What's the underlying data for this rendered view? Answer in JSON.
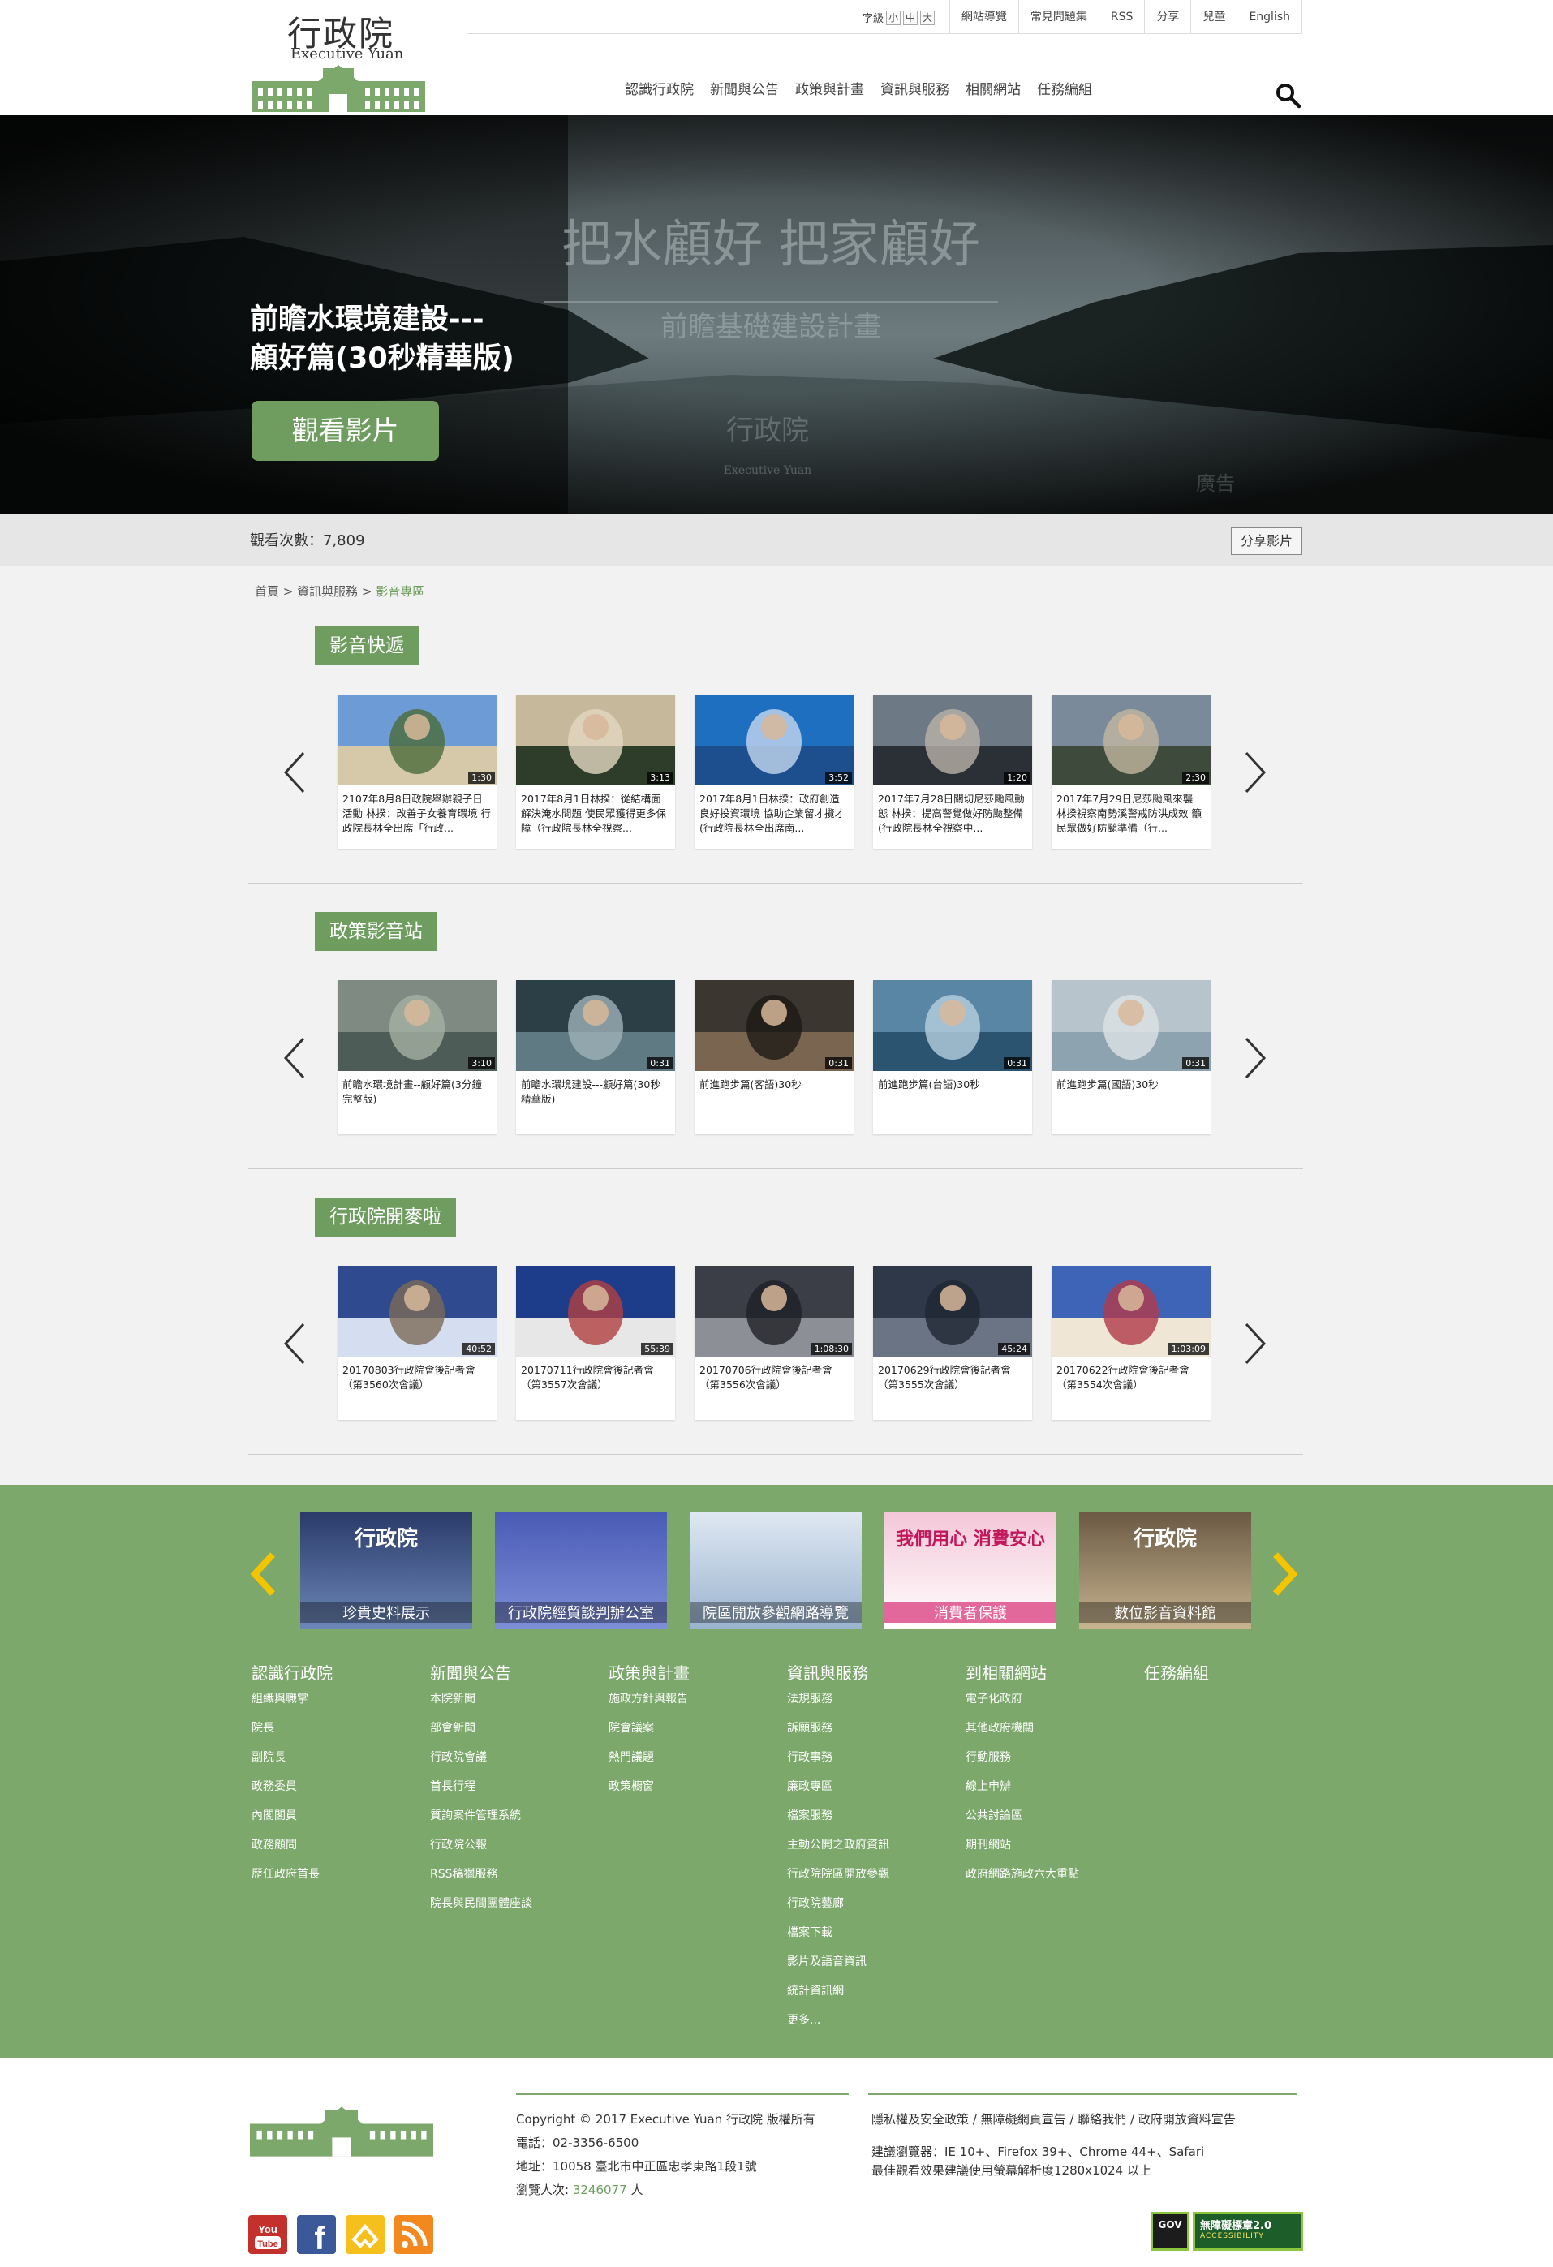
{
  "header": {
    "logo_title": "行政院",
    "logo_sub": "Executive Yuan",
    "font_size_label": "字級",
    "font_sizes": [
      "小",
      "中",
      "大"
    ],
    "top_links": [
      "網站導覽",
      "常見問題集",
      "RSS",
      "分享",
      "兒童",
      "English"
    ],
    "nav": [
      "認識行政院",
      "新聞與公告",
      "政策與計畫",
      "資訊與服務",
      "相關網站",
      "任務編組"
    ]
  },
  "hero": {
    "image_text": "把水顧好 把家顧好",
    "image_subtext": "前瞻基礎建設計畫",
    "watermark_title": "行政院",
    "watermark_sub": "Executive Yuan",
    "corner_text": "廣告",
    "title_line1": "前瞻水環境建設---",
    "title_line2": "顧好篇(30秒精華版)",
    "button": "觀看影片"
  },
  "viewbar": {
    "count_text": "觀看次數：7,809",
    "share": "分享影片"
  },
  "breadcrumb": {
    "home": "首頁",
    "sep": " > ",
    "parent": "資訊與服務",
    "current": "影音專區"
  },
  "sections": [
    {
      "title": "影音快遞",
      "cards": [
        {
          "duration": "1:30",
          "caption": "2107年8月8日政院舉辦親子日活動 林揆：改善子女養育環境 行政院長林全出席「行政..."
        },
        {
          "duration": "3:13",
          "caption": "2017年8月1日林揆：從結構面解決淹水問題 使民眾獲得更多保障（行政院長林全視察..."
        },
        {
          "duration": "3:52",
          "caption": "2017年8月1日林揆：政府創造良好投資環境 協助企業留才攬才(行政院長林全出席南..."
        },
        {
          "duration": "1:20",
          "caption": "2017年7月28日關切尼莎颱風動態 林揆：提高警覺做好防颱整備(行政院長林全視察中..."
        },
        {
          "duration": "2:30",
          "caption": "2017年7月29日尼莎颱風來襲 林揆視察南勢溪警戒防洪成效 籲民眾做好防颱準備（行..."
        }
      ]
    },
    {
      "title": "政策影音站",
      "cards": [
        {
          "duration": "3:10",
          "caption": "前瞻水環境計畫--顧好篇(3分鐘完整版)"
        },
        {
          "duration": "0:31",
          "caption": "前瞻水環境建設---顧好篇(30秒精華版)"
        },
        {
          "duration": "0:31",
          "caption": "前進跑步篇(客語)30秒"
        },
        {
          "duration": "0:31",
          "caption": "前進跑步篇(台語)30秒"
        },
        {
          "duration": "0:31",
          "caption": "前進跑步篇(國語)30秒"
        }
      ]
    },
    {
      "title": "行政院開麥啦",
      "cards": [
        {
          "duration": "40:52",
          "caption": "20170803行政院會後記者會（第3560次會議）"
        },
        {
          "duration": "55:39",
          "caption": "20170711行政院會後記者會（第3557次會議）"
        },
        {
          "duration": "1:08:30",
          "caption": "20170706行政院會後記者會（第3556次會議）"
        },
        {
          "duration": "45:24",
          "caption": "20170629行政院會後記者會（第3555次會議）"
        },
        {
          "duration": "1:03:09",
          "caption": "20170622行政院會後記者會（第3554次會議）"
        }
      ]
    }
  ],
  "banners": [
    {
      "label": "珍貴史料展示",
      "top": "行政院"
    },
    {
      "label": "行政院經貿談判辦公室",
      "top": ""
    },
    {
      "label": "院區開放參觀網路導覽",
      "top": ""
    },
    {
      "label": "消費者保護",
      "top": "我們用心 消費安心"
    },
    {
      "label": "數位影音資料館",
      "top": "行政院"
    }
  ],
  "footer_columns": [
    {
      "heading": "認識行政院",
      "items": [
        "組織與職掌",
        "院長",
        "副院長",
        "政務委員",
        "內閣閣員",
        "政務顧問",
        "歷任政府首長"
      ]
    },
    {
      "heading": "新聞與公告",
      "items": [
        "本院新聞",
        "部會新聞",
        "行政院會議",
        "首長行程",
        "質詢案件管理系統",
        "行政院公報",
        "RSS稿獵服務",
        "院長與民間團體座談"
      ]
    },
    {
      "heading": "政策與計畫",
      "items": [
        "施政方針與報告",
        "院會議案",
        "熱門議題",
        "政策櫥窗"
      ]
    },
    {
      "heading": "資訊與服務",
      "items": [
        "法規服務",
        "訴願服務",
        "行政事務",
        "廉政專區",
        "檔案服務",
        "主動公開之政府資訊",
        "行政院院區開放參觀",
        "行政院藝廊",
        "檔案下載",
        "影片及語音資訊",
        "統計資訊網",
        "更多..."
      ]
    },
    {
      "heading": "到相關網站",
      "items": [
        "電子化政府",
        "其他政府機關",
        "行動服務",
        "線上申辦",
        "公共討論區",
        "期刊網站",
        "政府網路施政六大重點"
      ]
    },
    {
      "heading": "任務編組",
      "items": []
    }
  ],
  "footer": {
    "copyright": "Copyright © 2017 Executive Yuan 行政院 版權所有",
    "phone": "電話：02-3356-6500",
    "address": "地址：10058 臺北市中正區忠孝東路1段1號",
    "visitors_label": "瀏覽人次:",
    "visitors": "3246077",
    "visitors_unit": "人",
    "policy_links": "隱私權及安全政策 / 無障礙網頁宣告 / 聯絡我們 / 政府開放資料宣告",
    "browsers": "建議瀏覽器：IE 10+、Firefox 39+、Chrome 44+、Safari",
    "resolution": "最佳觀看效果建議使用螢幕解析度1280x1024 以上",
    "gov_badge": "GOV",
    "a11y_badge_title": "無障礙標章2.0",
    "a11y_badge_sub": "ACCESSIBILITY",
    "social": [
      "YouTube",
      "Facebook",
      "Flickr",
      "RSS"
    ]
  },
  "colors": {
    "brand_green": "#6e9d5f",
    "footer_green": "#7ca86c",
    "arrow_yellow": "#f5c400"
  }
}
